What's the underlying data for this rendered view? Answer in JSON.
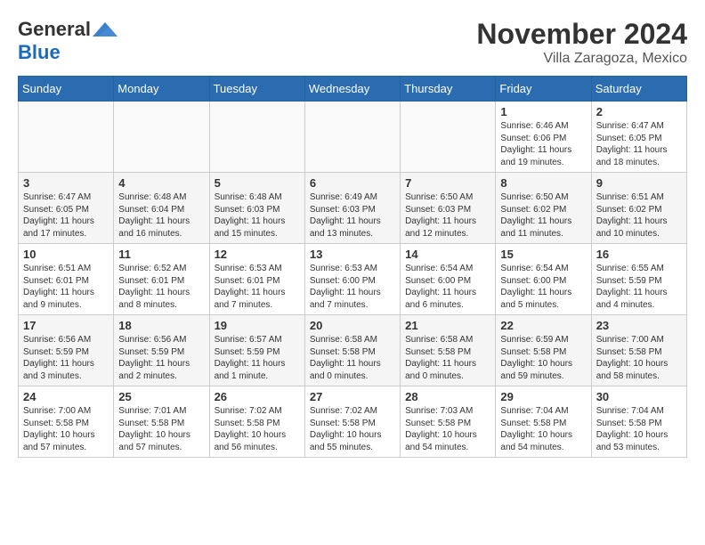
{
  "header": {
    "logo_general": "General",
    "logo_blue": "Blue",
    "month_year": "November 2024",
    "location": "Villa Zaragoza, Mexico"
  },
  "weekdays": [
    "Sunday",
    "Monday",
    "Tuesday",
    "Wednesday",
    "Thursday",
    "Friday",
    "Saturday"
  ],
  "weeks": [
    [
      {
        "day": "",
        "info": ""
      },
      {
        "day": "",
        "info": ""
      },
      {
        "day": "",
        "info": ""
      },
      {
        "day": "",
        "info": ""
      },
      {
        "day": "",
        "info": ""
      },
      {
        "day": "1",
        "info": "Sunrise: 6:46 AM\nSunset: 6:06 PM\nDaylight: 11 hours\nand 19 minutes."
      },
      {
        "day": "2",
        "info": "Sunrise: 6:47 AM\nSunset: 6:05 PM\nDaylight: 11 hours\nand 18 minutes."
      }
    ],
    [
      {
        "day": "3",
        "info": "Sunrise: 6:47 AM\nSunset: 6:05 PM\nDaylight: 11 hours\nand 17 minutes."
      },
      {
        "day": "4",
        "info": "Sunrise: 6:48 AM\nSunset: 6:04 PM\nDaylight: 11 hours\nand 16 minutes."
      },
      {
        "day": "5",
        "info": "Sunrise: 6:48 AM\nSunset: 6:03 PM\nDaylight: 11 hours\nand 15 minutes."
      },
      {
        "day": "6",
        "info": "Sunrise: 6:49 AM\nSunset: 6:03 PM\nDaylight: 11 hours\nand 13 minutes."
      },
      {
        "day": "7",
        "info": "Sunrise: 6:50 AM\nSunset: 6:03 PM\nDaylight: 11 hours\nand 12 minutes."
      },
      {
        "day": "8",
        "info": "Sunrise: 6:50 AM\nSunset: 6:02 PM\nDaylight: 11 hours\nand 11 minutes."
      },
      {
        "day": "9",
        "info": "Sunrise: 6:51 AM\nSunset: 6:02 PM\nDaylight: 11 hours\nand 10 minutes."
      }
    ],
    [
      {
        "day": "10",
        "info": "Sunrise: 6:51 AM\nSunset: 6:01 PM\nDaylight: 11 hours\nand 9 minutes."
      },
      {
        "day": "11",
        "info": "Sunrise: 6:52 AM\nSunset: 6:01 PM\nDaylight: 11 hours\nand 8 minutes."
      },
      {
        "day": "12",
        "info": "Sunrise: 6:53 AM\nSunset: 6:01 PM\nDaylight: 11 hours\nand 7 minutes."
      },
      {
        "day": "13",
        "info": "Sunrise: 6:53 AM\nSunset: 6:00 PM\nDaylight: 11 hours\nand 7 minutes."
      },
      {
        "day": "14",
        "info": "Sunrise: 6:54 AM\nSunset: 6:00 PM\nDaylight: 11 hours\nand 6 minutes."
      },
      {
        "day": "15",
        "info": "Sunrise: 6:54 AM\nSunset: 6:00 PM\nDaylight: 11 hours\nand 5 minutes."
      },
      {
        "day": "16",
        "info": "Sunrise: 6:55 AM\nSunset: 5:59 PM\nDaylight: 11 hours\nand 4 minutes."
      }
    ],
    [
      {
        "day": "17",
        "info": "Sunrise: 6:56 AM\nSunset: 5:59 PM\nDaylight: 11 hours\nand 3 minutes."
      },
      {
        "day": "18",
        "info": "Sunrise: 6:56 AM\nSunset: 5:59 PM\nDaylight: 11 hours\nand 2 minutes."
      },
      {
        "day": "19",
        "info": "Sunrise: 6:57 AM\nSunset: 5:59 PM\nDaylight: 11 hours\nand 1 minute."
      },
      {
        "day": "20",
        "info": "Sunrise: 6:58 AM\nSunset: 5:58 PM\nDaylight: 11 hours\nand 0 minutes."
      },
      {
        "day": "21",
        "info": "Sunrise: 6:58 AM\nSunset: 5:58 PM\nDaylight: 11 hours\nand 0 minutes."
      },
      {
        "day": "22",
        "info": "Sunrise: 6:59 AM\nSunset: 5:58 PM\nDaylight: 10 hours\nand 59 minutes."
      },
      {
        "day": "23",
        "info": "Sunrise: 7:00 AM\nSunset: 5:58 PM\nDaylight: 10 hours\nand 58 minutes."
      }
    ],
    [
      {
        "day": "24",
        "info": "Sunrise: 7:00 AM\nSunset: 5:58 PM\nDaylight: 10 hours\nand 57 minutes."
      },
      {
        "day": "25",
        "info": "Sunrise: 7:01 AM\nSunset: 5:58 PM\nDaylight: 10 hours\nand 57 minutes."
      },
      {
        "day": "26",
        "info": "Sunrise: 7:02 AM\nSunset: 5:58 PM\nDaylight: 10 hours\nand 56 minutes."
      },
      {
        "day": "27",
        "info": "Sunrise: 7:02 AM\nSunset: 5:58 PM\nDaylight: 10 hours\nand 55 minutes."
      },
      {
        "day": "28",
        "info": "Sunrise: 7:03 AM\nSunset: 5:58 PM\nDaylight: 10 hours\nand 54 minutes."
      },
      {
        "day": "29",
        "info": "Sunrise: 7:04 AM\nSunset: 5:58 PM\nDaylight: 10 hours\nand 54 minutes."
      },
      {
        "day": "30",
        "info": "Sunrise: 7:04 AM\nSunset: 5:58 PM\nDaylight: 10 hours\nand 53 minutes."
      }
    ]
  ]
}
